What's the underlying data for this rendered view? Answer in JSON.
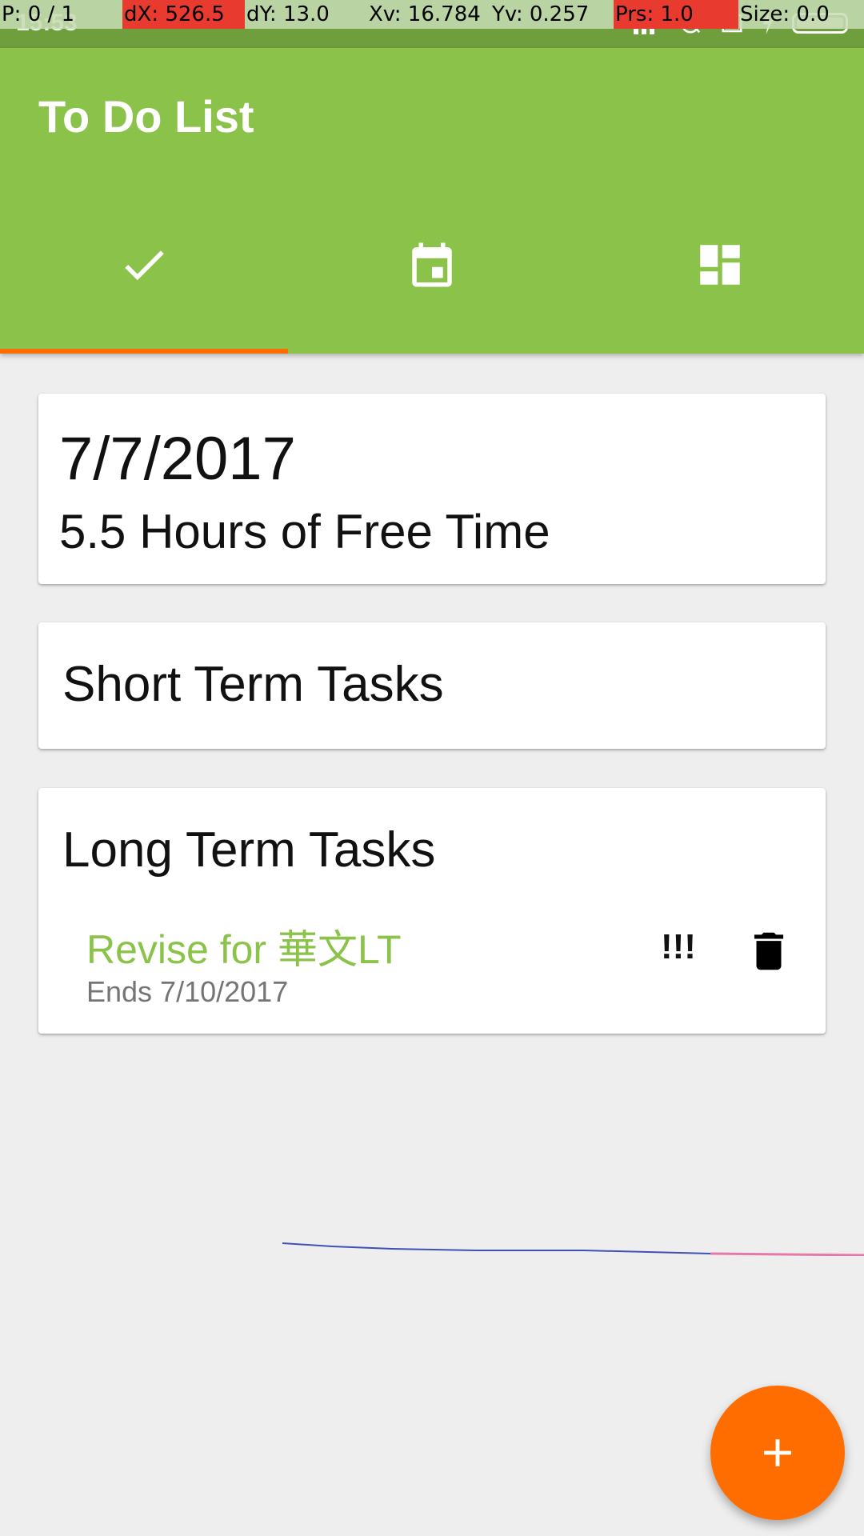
{
  "status_bar": {
    "time": "15:53"
  },
  "pointer_overlay": {
    "pointers": "P: 0 / 1",
    "dx": "dX: 526.5",
    "dy": "dY: 13.0",
    "xv": "Xv: 16.784",
    "yv": "Yv: 0.257",
    "prs": "Prs: 1.0",
    "size": "Size: 0.0"
  },
  "app_bar": {
    "title": "To Do List",
    "background": "#8bc34a",
    "tabs": [
      {
        "icon": "check-icon",
        "selected": true
      },
      {
        "icon": "calendar-icon",
        "selected": false
      },
      {
        "icon": "dashboard-icon",
        "selected": false
      }
    ],
    "indicator_color": "#ff6d00"
  },
  "date_card": {
    "date": "7/7/2017",
    "free_time": "5.5 Hours of Free Time"
  },
  "short_term": {
    "title": "Short Term Tasks"
  },
  "long_term": {
    "title": "Long Term Tasks",
    "tasks": [
      {
        "title": "Revise for 華文LT",
        "ends": "Ends 7/10/2017",
        "priority": "!!!",
        "icon": "delete-icon"
      }
    ]
  },
  "fab": {
    "icon": "plus-icon",
    "color": "#ff6d00"
  }
}
